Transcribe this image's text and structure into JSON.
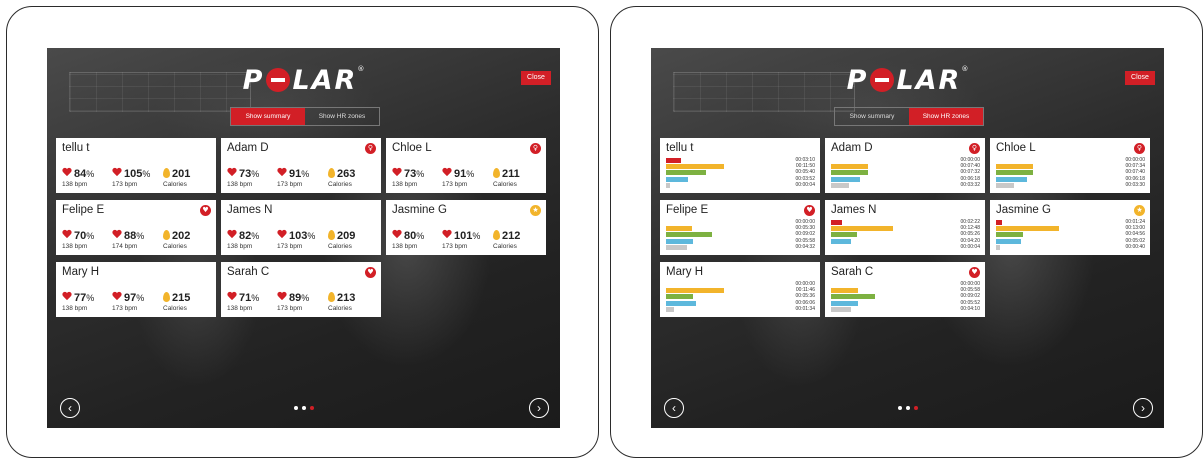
{
  "colors": {
    "accent": "#d21f26",
    "zone5": "#d21f26",
    "zone4": "#f2b42b",
    "zone3": "#7db141",
    "zone2": "#5db8dc",
    "zone1": "#c8c8c8",
    "gold": "#f2b42b"
  },
  "logo": {
    "text": "POLAR",
    "reg": "®"
  },
  "close_label": "Close",
  "toggle": {
    "summary_label": "Show summary",
    "zones_label": "Show HR zones"
  },
  "nav": {
    "prev_icon": "chevron-left-icon",
    "next_icon": "chevron-right-icon",
    "prev_glyph": "‹",
    "next_glyph": "›"
  },
  "summary_view": {
    "active_tab": "summary",
    "cards": [
      {
        "name": "tellu t",
        "badge": null,
        "hr_pct": "84",
        "hr_bpm": "138 bpm",
        "max_pct": "105",
        "max_bpm": "173 bpm",
        "calories": "201",
        "cal_label": "Calories"
      },
      {
        "name": "Adam D",
        "badge": "red",
        "badge_glyph": "♀",
        "hr_pct": "73",
        "hr_bpm": "138 bpm",
        "max_pct": "91",
        "max_bpm": "173 bpm",
        "calories": "263",
        "cal_label": "Calories"
      },
      {
        "name": "Chloe L",
        "badge": "red",
        "badge_glyph": "♀",
        "hr_pct": "73",
        "hr_bpm": "138 bpm",
        "max_pct": "91",
        "max_bpm": "173 bpm",
        "calories": "211",
        "cal_label": "Calories"
      },
      {
        "name": "Felipe E",
        "badge": "red",
        "badge_glyph": "♥",
        "hr_pct": "70",
        "hr_bpm": "138 bpm",
        "max_pct": "88",
        "max_bpm": "174 bpm",
        "calories": "202",
        "cal_label": "Calories"
      },
      {
        "name": "James N",
        "badge": null,
        "hr_pct": "82",
        "hr_bpm": "138 bpm",
        "max_pct": "103",
        "max_bpm": "173 bpm",
        "calories": "209",
        "cal_label": "Calories"
      },
      {
        "name": "Jasmine G",
        "badge": "gold",
        "badge_glyph": "★",
        "hr_pct": "80",
        "hr_bpm": "138 bpm",
        "max_pct": "101",
        "max_bpm": "173 bpm",
        "calories": "212",
        "cal_label": "Calories"
      },
      {
        "name": "Mary H",
        "badge": null,
        "hr_pct": "77",
        "hr_bpm": "138 bpm",
        "max_pct": "97",
        "max_bpm": "173 bpm",
        "calories": "215",
        "cal_label": "Calories"
      },
      {
        "name": "Sarah C",
        "badge": "red",
        "badge_glyph": "♥",
        "hr_pct": "71",
        "hr_bpm": "138 bpm",
        "max_pct": "89",
        "max_bpm": "173 bpm",
        "calories": "213",
        "cal_label": "Calories"
      }
    ]
  },
  "zones_view": {
    "active_tab": "zones",
    "cards": [
      {
        "name": "tellu t",
        "badge": null,
        "zones": [
          0.17,
          0.66,
          0.45,
          0.25,
          0.05
        ],
        "times": [
          "00:03:10",
          "00:11:50",
          "00:05:40",
          "00:03:52",
          "00:00:04"
        ]
      },
      {
        "name": "Adam D",
        "badge": "red",
        "badge_glyph": "♀",
        "zones": [
          0.0,
          0.42,
          0.42,
          0.33,
          0.2
        ],
        "times": [
          "00:00:00",
          "00:07:40",
          "00:07:32",
          "00:06:18",
          "00:03:32"
        ]
      },
      {
        "name": "Chloe L",
        "badge": "red",
        "badge_glyph": "♀",
        "zones": [
          0.0,
          0.42,
          0.42,
          0.35,
          0.2
        ],
        "times": [
          "00:00:00",
          "00:07:34",
          "00:07:40",
          "00:06:18",
          "00:03:30"
        ]
      },
      {
        "name": "Felipe E",
        "badge": "red",
        "badge_glyph": "♥",
        "zones": [
          0.0,
          0.3,
          0.52,
          0.31,
          0.24
        ],
        "times": [
          "00:00:00",
          "00:05:30",
          "00:09:02",
          "00:05:58",
          "00:04:32"
        ]
      },
      {
        "name": "James N",
        "badge": null,
        "zones": [
          0.12,
          0.7,
          0.29,
          0.23,
          0.0
        ],
        "times": [
          "00:02:22",
          "00:12:48",
          "00:05:26",
          "00:04:20",
          "00:00:04"
        ]
      },
      {
        "name": "Jasmine G",
        "badge": "gold",
        "badge_glyph": "★",
        "zones": [
          0.07,
          0.72,
          0.31,
          0.28,
          0.04
        ],
        "times": [
          "00:01:24",
          "00:13:00",
          "00:04:56",
          "00:05:02",
          "00:00:40"
        ]
      },
      {
        "name": "Mary H",
        "badge": null,
        "zones": [
          0.0,
          0.66,
          0.31,
          0.34,
          0.09
        ],
        "times": [
          "00:00:00",
          "00:11:46",
          "00:05:36",
          "00:06:06",
          "00:01:34"
        ]
      },
      {
        "name": "Sarah C",
        "badge": "red",
        "badge_glyph": "♥",
        "zones": [
          0.0,
          0.31,
          0.5,
          0.31,
          0.23
        ],
        "times": [
          "00:00:00",
          "00:05:58",
          "00:09:02",
          "00:05:52",
          "00:04:10"
        ]
      }
    ]
  },
  "pagination": {
    "count": 3,
    "active": 2
  }
}
